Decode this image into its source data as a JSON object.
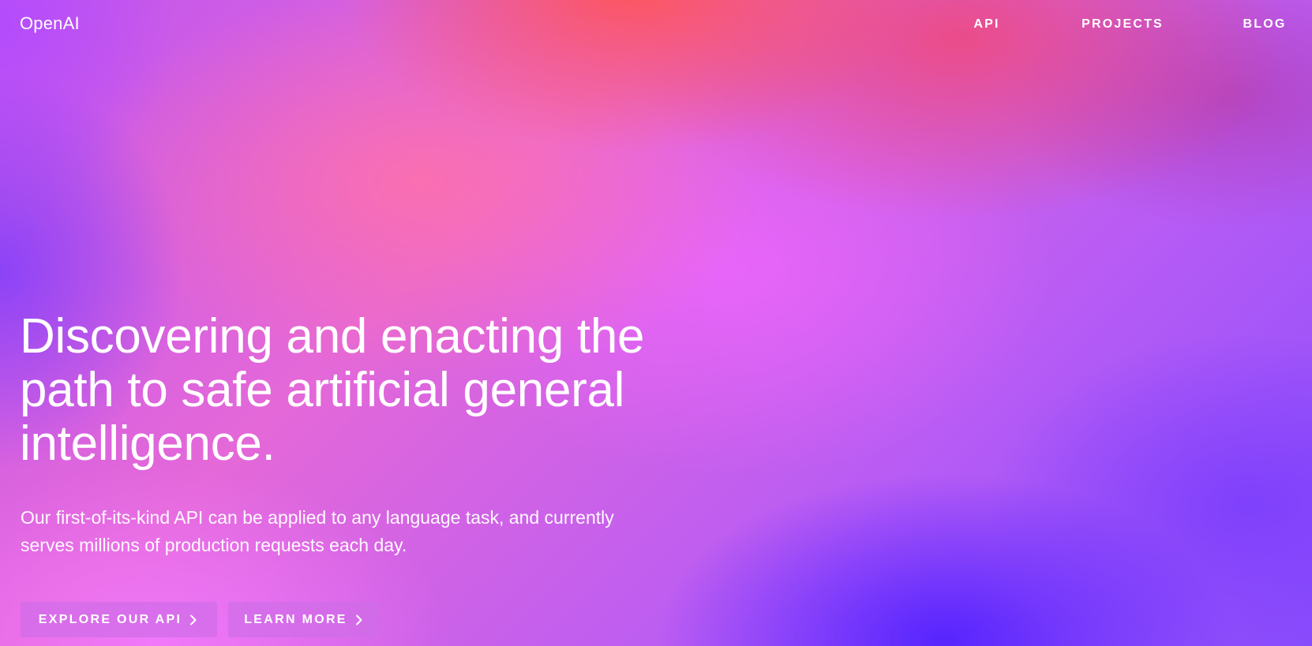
{
  "header": {
    "logo": "OpenAI",
    "nav": [
      {
        "label": "API"
      },
      {
        "label": "PROJECTS"
      },
      {
        "label": "BLOG"
      }
    ]
  },
  "hero": {
    "headline": "Discovering and enacting the path to safe artificial general intelligence.",
    "subtext": "Our first-of-its-kind API can be applied to any language task, and currently serves millions of production requests each day.",
    "buttons": [
      {
        "label": "EXPLORE OUR API",
        "icon": "chevron-right-icon"
      },
      {
        "label": "LEARN MORE",
        "icon": "chevron-right-icon"
      }
    ]
  },
  "colors": {
    "text": "#ffffff",
    "button_bg": "rgba(208,108,232,0.72)"
  }
}
